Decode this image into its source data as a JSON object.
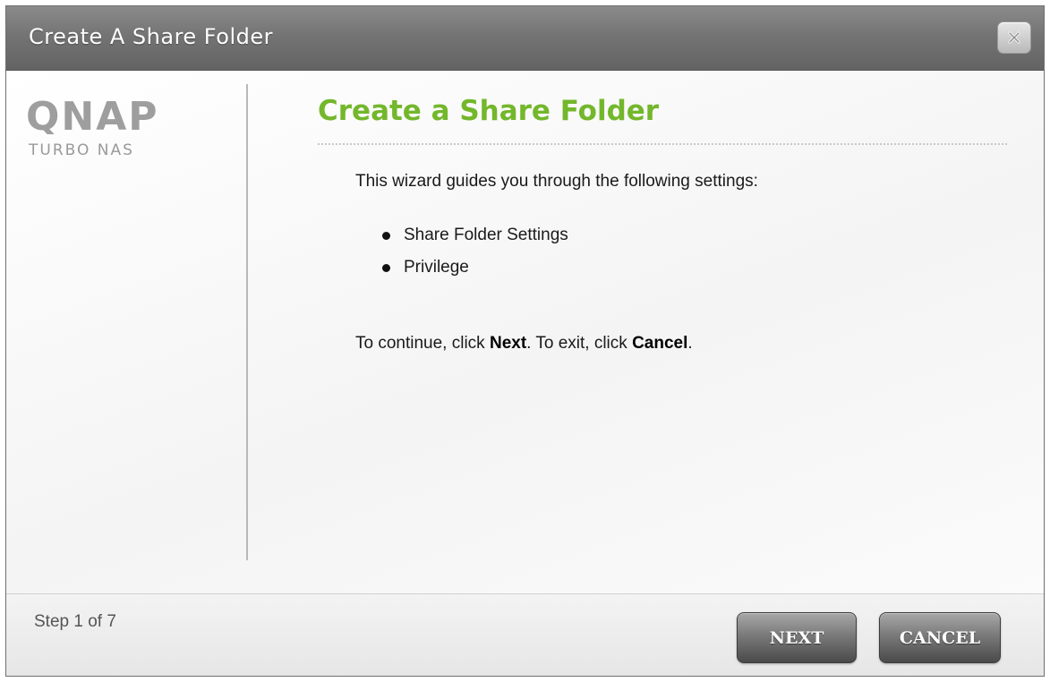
{
  "window": {
    "title": "Create A Share Folder",
    "close_icon": "close-icon"
  },
  "sidebar": {
    "logo_text": "QNAP",
    "logo_subtitle": "TURBO NAS"
  },
  "main": {
    "title": "Create a Share Folder",
    "intro": "This wizard guides you through the following settings:",
    "items": [
      {
        "label": "Share Folder Settings"
      },
      {
        "label": "Privilege"
      }
    ],
    "instructions": {
      "prefix": "To continue, click ",
      "next_word": "Next",
      "middle": ". To exit, click ",
      "cancel_word": "Cancel",
      "suffix": "."
    }
  },
  "footer": {
    "step": "Step 1 of 7",
    "next_label": "NEXT",
    "cancel_label": "CANCEL"
  },
  "colors": {
    "title_green": "#73b72b",
    "titlebar_gray": "#747474",
    "button_dark": "#4a4a4a"
  }
}
